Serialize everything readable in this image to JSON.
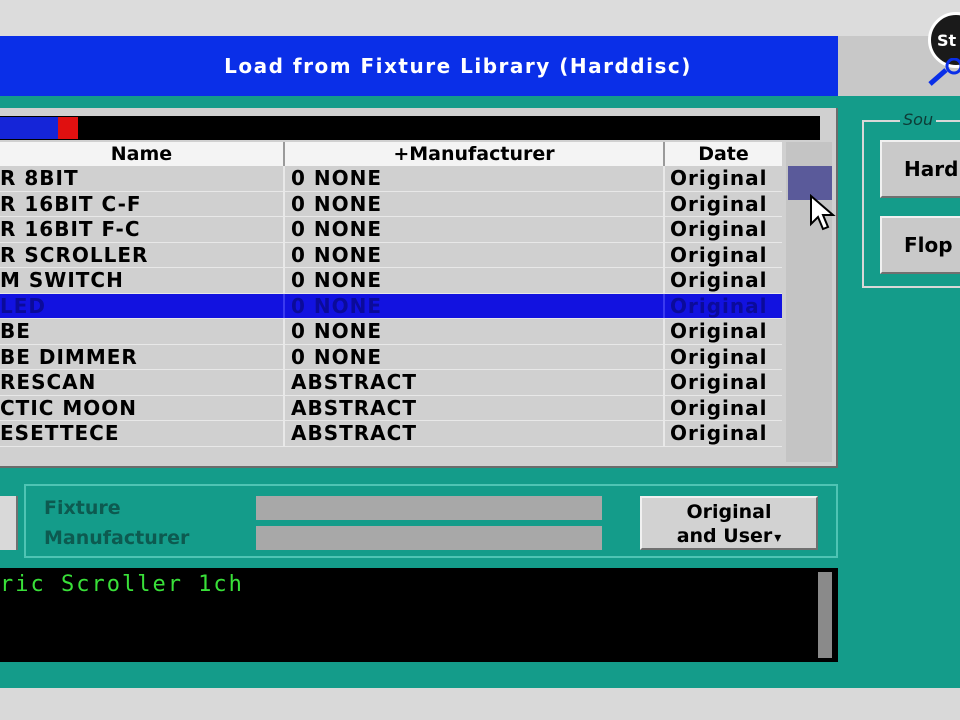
{
  "window": {
    "title": "Load from Fixture Library (Harddisc)",
    "logo_text": "St"
  },
  "table": {
    "columns": [
      "Name",
      "+Manufacturer",
      "Date"
    ],
    "rows": [
      {
        "name": "R  8BIT",
        "manufacturer": "0 NONE",
        "date": "Original"
      },
      {
        "name": "R 16BIT C-F",
        "manufacturer": "0 NONE",
        "date": "Original"
      },
      {
        "name": "R 16BIT F-C",
        "manufacturer": "0 NONE",
        "date": "Original"
      },
      {
        "name": "R SCROLLER",
        "manufacturer": "0 NONE",
        "date": "Original"
      },
      {
        "name": "M SWITCH",
        "manufacturer": "0 NONE",
        "date": "Original"
      },
      {
        "name": "LED",
        "manufacturer": "0 NONE",
        "date": "Original"
      },
      {
        "name": "BE",
        "manufacturer": "0 NONE",
        "date": "Original"
      },
      {
        "name": "BE DIMMER",
        "manufacturer": "0 NONE",
        "date": "Original"
      },
      {
        "name": "RESCAN",
        "manufacturer": "ABSTRACT",
        "date": "Original"
      },
      {
        "name": "CTIC MOON",
        "manufacturer": "ABSTRACT",
        "date": "Original"
      },
      {
        "name": "ESETTECE",
        "manufacturer": "ABSTRACT",
        "date": "Original"
      }
    ],
    "selected_index": 5,
    "load_progress": 0.09
  },
  "source": {
    "label": "Sou",
    "harddisc_label": "Hard",
    "floppy_label": "Flop"
  },
  "filter": {
    "fixture_label": "Fixture",
    "manufacturer_label": "Manufacturer",
    "fixture_value": "",
    "manufacturer_value": "",
    "mode_line1": "Original",
    "mode_line2": "and User"
  },
  "console": {
    "text": "ric Scroller 1ch"
  },
  "colors": {
    "title_bar": "#0a2fe8",
    "panel": "#149c8a",
    "selection": "#1212e0",
    "console_text": "#39e039"
  }
}
